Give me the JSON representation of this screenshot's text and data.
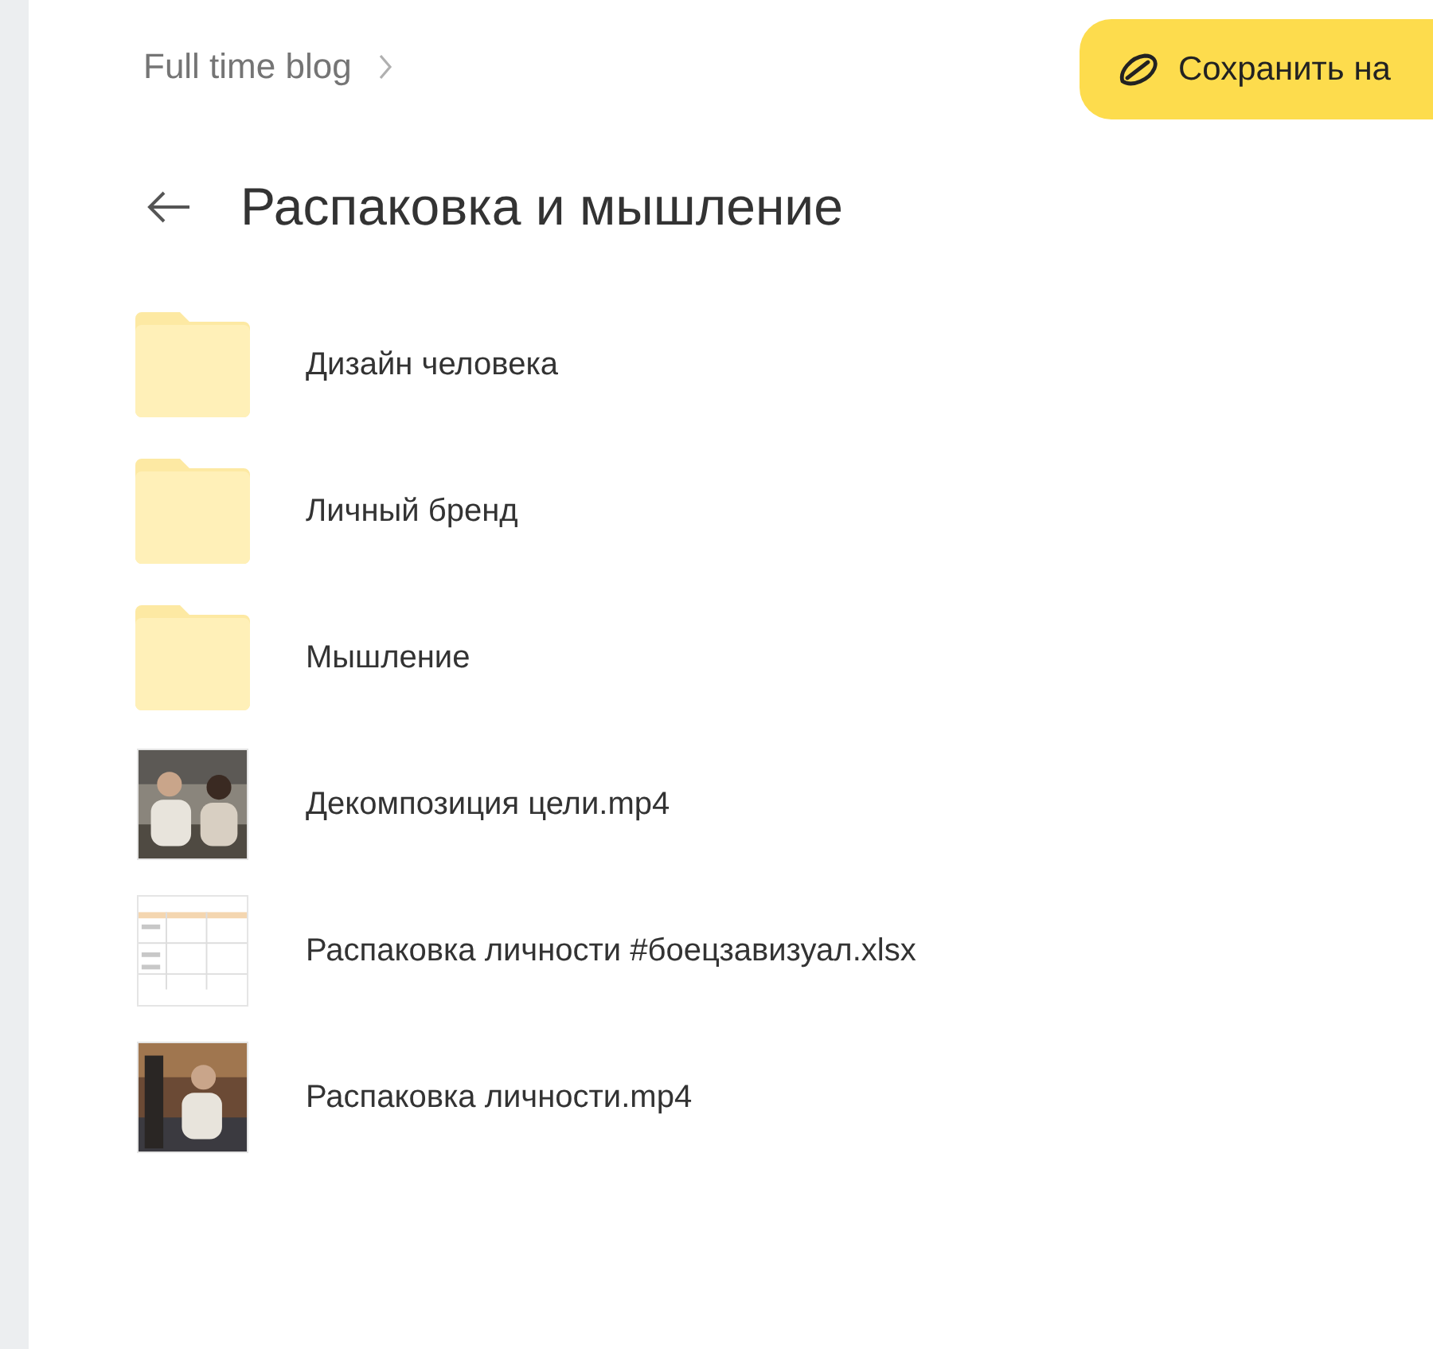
{
  "breadcrumb": {
    "label": "Full time blog"
  },
  "save_button": {
    "label": "Сохранить на"
  },
  "title": "Распаковка и мышление",
  "items": [
    {
      "kind": "folder",
      "name": "Дизайн человека"
    },
    {
      "kind": "folder",
      "name": "Личный бренд"
    },
    {
      "kind": "folder",
      "name": "Мышление"
    },
    {
      "kind": "video",
      "name": "Декомпозиция цели.mp4"
    },
    {
      "kind": "spreadsheet",
      "name": "Распаковка личности #боецзавизуал.xlsx"
    },
    {
      "kind": "video",
      "name": "Распаковка личности.mp4"
    }
  ]
}
